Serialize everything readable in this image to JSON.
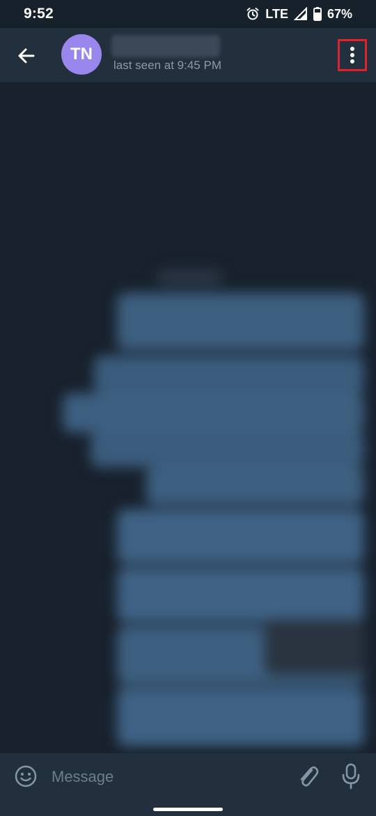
{
  "status_bar": {
    "time": "9:52",
    "network": "LTE",
    "battery": "67%",
    "icons": [
      "alarm-icon",
      "signal-icon",
      "battery-icon"
    ]
  },
  "header": {
    "avatar_initials": "TN",
    "avatar_color": "#9a87ee",
    "contact_name": "",
    "last_seen": "last seen at 9:45 PM",
    "icons": [
      "back-arrow-icon",
      "more-vertical-icon"
    ],
    "highlight_color": "#e0202b"
  },
  "composer": {
    "placeholder": "Message",
    "value": "",
    "icons": [
      "emoji-icon",
      "paperclip-icon",
      "microphone-icon"
    ]
  },
  "colors": {
    "background": "#18212c",
    "bar": "#222f3c",
    "outgoing_bubble": "#3f6285",
    "incoming_bubble": "#2a3a4b"
  }
}
